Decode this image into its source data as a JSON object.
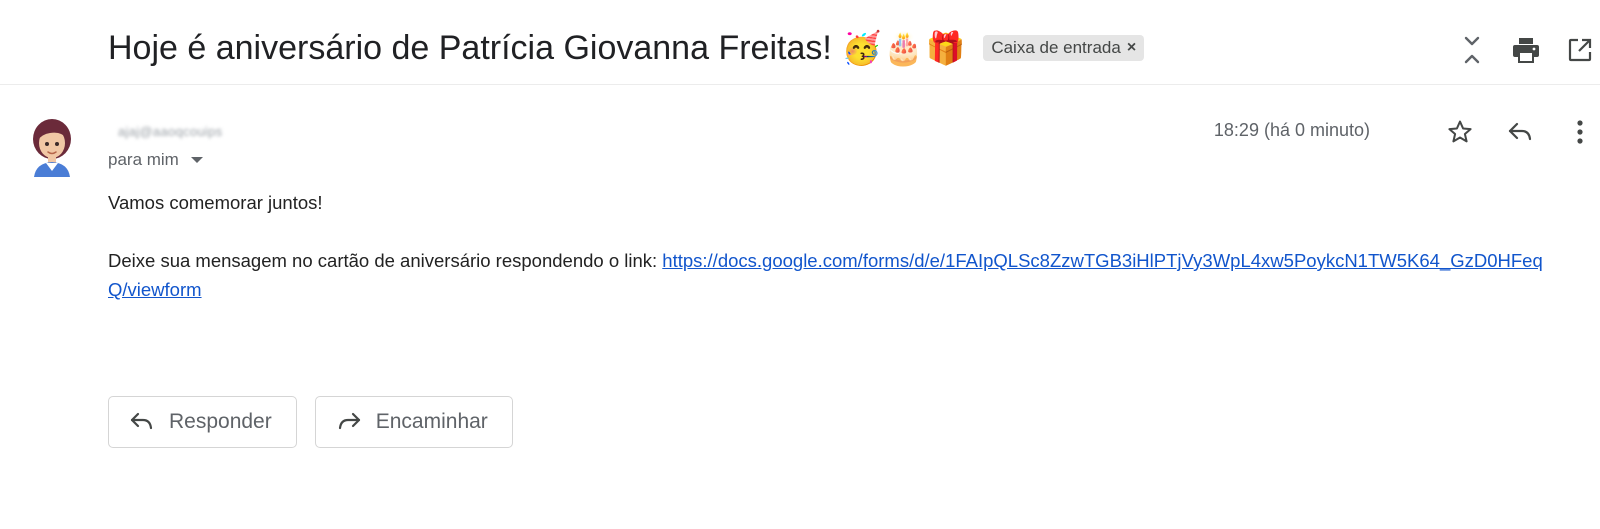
{
  "header": {
    "subject": "Hoje é aniversário de Patrícia Giovanna Freitas!",
    "subject_emojis": "🥳🎂🎁",
    "label_chip": "Caixa de entrada",
    "label_chip_close": "×"
  },
  "message": {
    "sender": "ajaj@aaoqcouips",
    "recipient": "para mim",
    "timestamp": "18:29 (há 0 minuto)",
    "body_line1": "Vamos comemorar juntos!",
    "body_line2_prefix": "Deixe sua mensagem no cartão de aniversário respondendo o link: ",
    "link_text": "https://docs.google.com/forms/d/e/1FAIpQLSc8ZzwTGB3iHlPTjVy3WpL4xw5PoykcN1TW5K64_GzD0HFeqQ/viewform",
    "link_href": "https://docs.google.com/forms/d/e/1FAIpQLSc8ZzwTGB3iHlPTjVy3WpL4xw5PoykcN1TW5K64_GzD0HFeqQ/viewform"
  },
  "actions": {
    "reply_label": "Responder",
    "forward_label": "Encaminhar"
  },
  "icons": {
    "collapse": "collapse-all-icon",
    "print": "print-icon",
    "open_new_window": "open-in-new-window-icon",
    "star": "star-icon",
    "reply": "reply-icon",
    "more": "more-vert-icon",
    "forward": "forward-icon",
    "avatar": "avatar-icon"
  },
  "colors": {
    "link": "#1155cc",
    "chip_bg": "#e5e5e5",
    "muted_text": "#5f6368"
  }
}
